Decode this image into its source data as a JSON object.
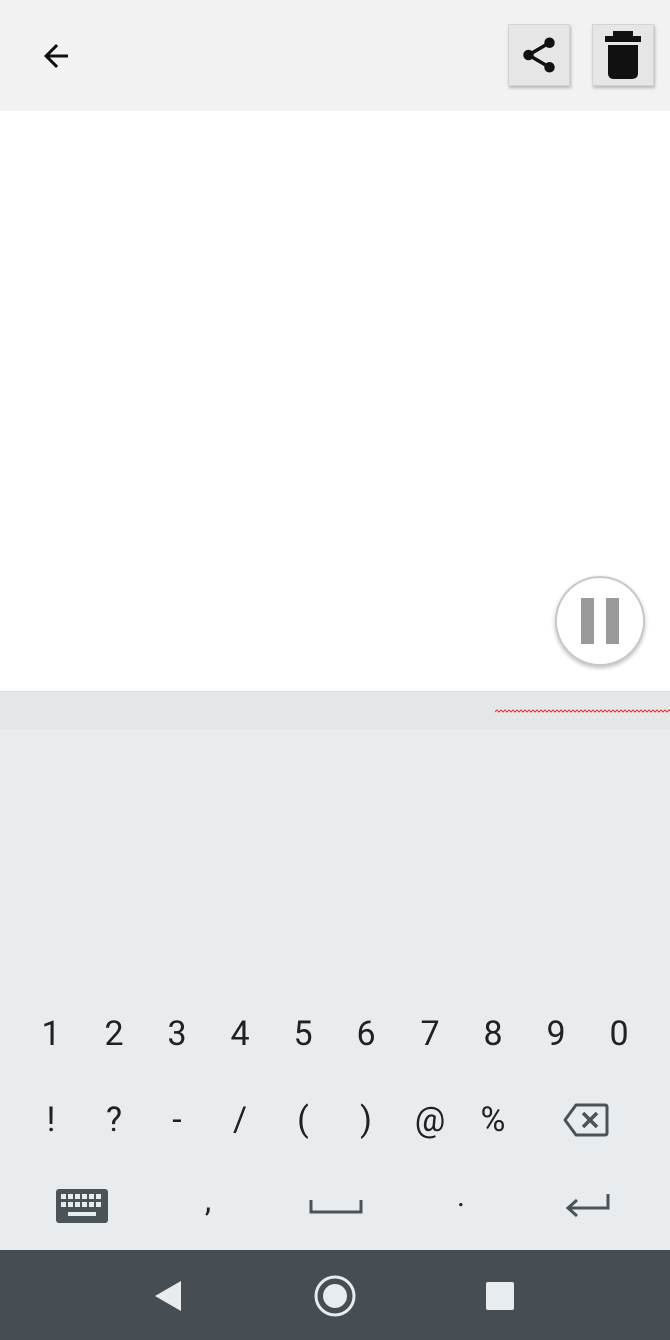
{
  "app_bar": {
    "back_icon": "arrow-back-icon",
    "share_icon": "share-icon",
    "delete_icon": "trash-icon"
  },
  "player": {
    "pause_icon": "pause-icon"
  },
  "keyboard": {
    "row1": [
      "1",
      "2",
      "3",
      "4",
      "5",
      "6",
      "7",
      "8",
      "9",
      "0"
    ],
    "row2": [
      "!",
      "?",
      "-",
      "/",
      "(",
      ")",
      "@",
      "%"
    ],
    "row3": {
      "keyboard_switch_icon": "keyboard-icon",
      "comma": ",",
      "space_icon": "space-icon",
      "period": ".",
      "enter_icon": "enter-icon"
    },
    "backspace_icon": "backspace-icon"
  },
  "nav": {
    "back_icon": "nav-back-icon",
    "home_icon": "nav-home-icon",
    "recents_icon": "nav-recents-icon"
  },
  "colors": {
    "app_bar_bg": "#f2f2f2",
    "keyboard_bg": "#e9ecee",
    "nav_bg": "#474e53",
    "spellcheck": "#e53935"
  }
}
